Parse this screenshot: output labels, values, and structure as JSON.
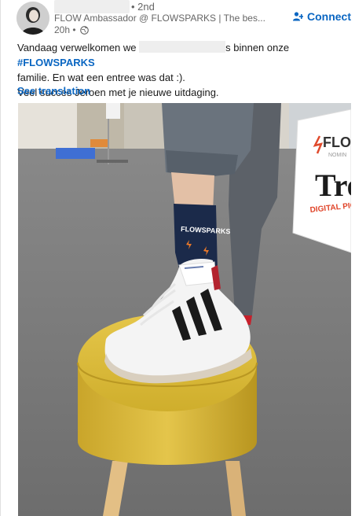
{
  "author": {
    "degree": "• 2nd",
    "headline": "FLOW Ambassador @ FLOWSPARKS | The bes...",
    "time": "20h •"
  },
  "connect_label": "Connect",
  "post": {
    "line1_a": "Vandaag verwelkomen we",
    "line1_b": "s binnen onze ",
    "hashtag": "#FLOWSPARKS",
    "line2": " familie. En wat een entree was dat :).",
    "line3": "Veel succes Jeroen met je nieuwe uitdaging.",
    "see_translation": "See translation"
  },
  "photo": {
    "sock_text": "FLOWSPARKS",
    "banner_logo": "FLO",
    "banner_sub": "NOMIN",
    "banner_big": "Tre",
    "banner_digital": "DIGITAL PIONEER"
  },
  "colors": {
    "link": "#0a66c2",
    "stool": "#d9b634",
    "sock": "#1b2a4a"
  }
}
